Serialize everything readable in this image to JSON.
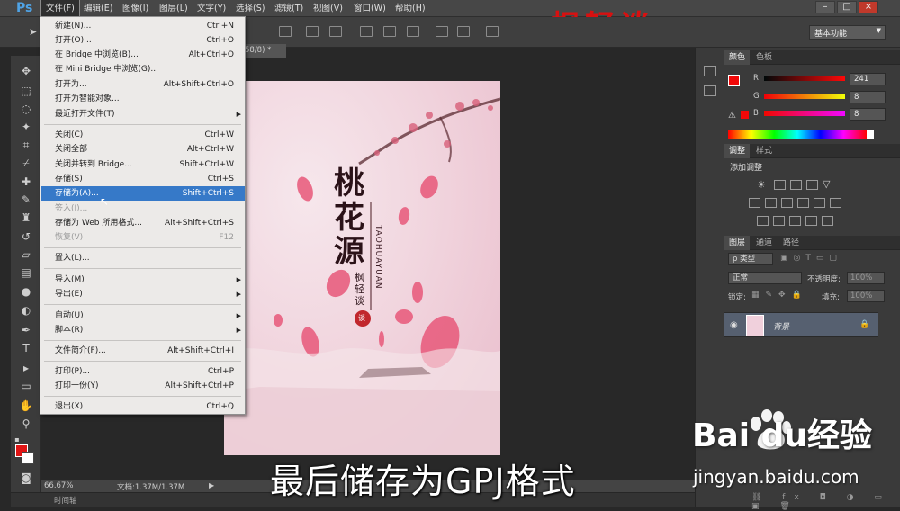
{
  "app": {
    "logo": "Ps"
  },
  "menubar": {
    "items": [
      "文件(F)",
      "编辑(E)",
      "图像(I)",
      "图层(L)",
      "文字(Y)",
      "选择(S)",
      "滤镜(T)",
      "视图(V)",
      "窗口(W)",
      "帮助(H)"
    ],
    "window_buttons": [
      "–",
      "□",
      "×"
    ]
  },
  "watermark_top": "枫轻谈",
  "options": {
    "workspace": "基本功能"
  },
  "document": {
    "tab": "58/8) *",
    "zoom": "66.67%",
    "doc_size": "文档:1.37M/1.37M",
    "timeline": "时间轴",
    "art": {
      "title_chars": [
        "桃",
        "花",
        "源"
      ],
      "pinyin": "TAOHUAYUAN",
      "author": [
        "枫",
        "轻",
        "谈"
      ],
      "seal": "谈"
    }
  },
  "file_menu": {
    "items": [
      {
        "label": "新建(N)...",
        "shortcut": "Ctrl+N"
      },
      {
        "label": "打开(O)...",
        "shortcut": "Ctrl+O"
      },
      {
        "label": "在 Bridge 中浏览(B)...",
        "shortcut": "Alt+Ctrl+O"
      },
      {
        "label": "在 Mini Bridge 中浏览(G)...",
        "shortcut": ""
      },
      {
        "label": "打开为...",
        "shortcut": "Alt+Shift+Ctrl+O"
      },
      {
        "label": "打开为智能对象...",
        "shortcut": ""
      },
      {
        "label": "最近打开文件(T)",
        "shortcut": ""
      },
      {
        "label": "关闭(C)",
        "shortcut": "Ctrl+W"
      },
      {
        "label": "关闭全部",
        "shortcut": "Alt+Ctrl+W"
      },
      {
        "label": "关闭并转到 Bridge...",
        "shortcut": "Shift+Ctrl+W"
      },
      {
        "label": "存储(S)",
        "shortcut": "Ctrl+S"
      },
      {
        "label": "存储为(A)...",
        "shortcut": "Shift+Ctrl+S"
      },
      {
        "label": "签入(I)...",
        "shortcut": ""
      },
      {
        "label": "存储为 Web 所用格式...",
        "shortcut": "Alt+Shift+Ctrl+S"
      },
      {
        "label": "恢复(V)",
        "shortcut": "F12"
      },
      {
        "label": "置入(L)...",
        "shortcut": ""
      },
      {
        "label": "导入(M)",
        "shortcut": ""
      },
      {
        "label": "导出(E)",
        "shortcut": ""
      },
      {
        "label": "自动(U)",
        "shortcut": ""
      },
      {
        "label": "脚本(R)",
        "shortcut": ""
      },
      {
        "label": "文件简介(F)...",
        "shortcut": "Alt+Shift+Ctrl+I"
      },
      {
        "label": "打印(P)...",
        "shortcut": "Ctrl+P"
      },
      {
        "label": "打印一份(Y)",
        "shortcut": "Alt+Shift+Ctrl+P"
      },
      {
        "label": "退出(X)",
        "shortcut": "Ctrl+Q"
      }
    ]
  },
  "color_panel": {
    "tabs": [
      "颜色",
      "色板"
    ],
    "channels": [
      {
        "label": "R",
        "value": "241"
      },
      {
        "label": "G",
        "value": "8"
      },
      {
        "label": "B",
        "value": "8"
      }
    ],
    "foreground": "#f10808"
  },
  "adjust_panel": {
    "tabs": [
      "调整",
      "样式"
    ],
    "title": "添加调整"
  },
  "layers_panel": {
    "tabs": [
      "图层",
      "通道",
      "路径"
    ],
    "kind": "类型",
    "blend": "正常",
    "opacity_label": "不透明度:",
    "opacity": "100%",
    "lock_label": "锁定:",
    "fill_label": "填充:",
    "fill": "100%",
    "layer_name": "背景"
  },
  "overlays": {
    "caption": "最后储存为GPJ格式",
    "baidu_logo": "Bai du经验",
    "baidu_url": "jingyan.baidu.com"
  }
}
